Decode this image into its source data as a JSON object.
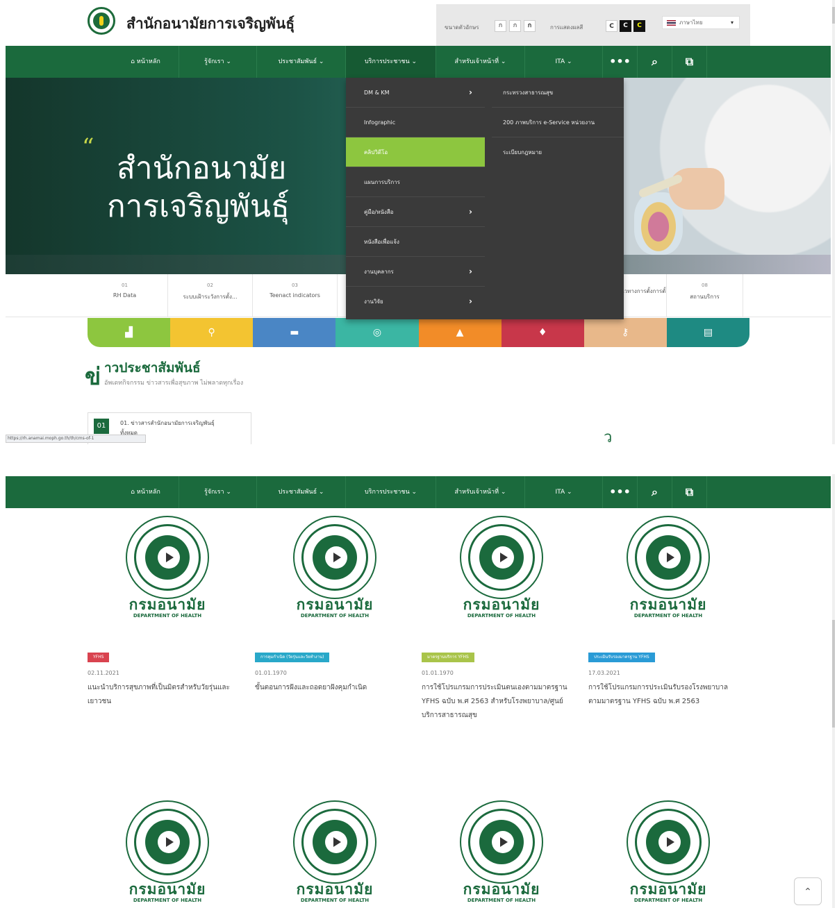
{
  "header": {
    "site_title": "สำนักอนามัยการเจริญพันธุ์",
    "font_size_label": "ขนาดตัวอักษร",
    "font_sizes": [
      "ก",
      "ก",
      "ก"
    ],
    "contrast_label": "การแสดงผลสี",
    "contrast_opts": [
      "C",
      "C",
      "C"
    ],
    "language": "ภาษาไทย"
  },
  "nav": {
    "home": "หน้าหลัก",
    "about": "รู้จักเรา",
    "pr": "ประชาสัมพันธ์",
    "services": "บริการประชาชน",
    "staff": "สำหรับเจ้าหน้าที่",
    "ita": "ITA"
  },
  "hero": {
    "line1": "สำนักอนามัย",
    "line2": "การเจริญพันธุ์"
  },
  "dropdown": {
    "col1": [
      {
        "label": "DM & KM",
        "arrow": true
      },
      {
        "label": "Infographic",
        "arrow": false
      },
      {
        "label": "คลิปวิดีโอ",
        "arrow": false
      },
      {
        "label": "แผนการบริการ",
        "arrow": false
      },
      {
        "label": "คู่มือ/หนังสือ",
        "arrow": true
      },
      {
        "label": "หนังสือเพื่อแจ้ง",
        "arrow": false
      },
      {
        "label": "งานบุคลากร",
        "arrow": true
      },
      {
        "label": "งานวิจัย",
        "arrow": true
      }
    ],
    "col2": [
      "กระทรวงสาธารณสุข",
      "200 ภาพบริการ e-Service หน่วยงาน",
      "ระเบียบกฎหมาย"
    ]
  },
  "subtabs": [
    {
      "num": "01",
      "label": "RH Data"
    },
    {
      "num": "02",
      "label": "ระบบเฝ้าระวังการตั้ง..."
    },
    {
      "num": "03",
      "label": "Teenact indicators"
    },
    {
      "num": "",
      "label": ""
    },
    {
      "num": "",
      "label": ""
    },
    {
      "num": "",
      "label": ""
    },
    {
      "num": "",
      "label": ""
    },
    {
      "num": "",
      "label": "แนวทางการตั้งการตั้งน"
    },
    {
      "num": "08",
      "label": "สถานบริการ"
    }
  ],
  "news": {
    "title_big": "ข่",
    "title": "าวประชาสัมพันธ์",
    "subtitle": "อัพเดทกิจกรรม ข่าวสารเพื่อสุขภาพ ไม่พลาดทุกเรื่อง",
    "card_icon": "01",
    "card_text": "01. ข่าวสารสำนักอนามัยการเจริญพันธุ์",
    "card_text2": "ทั้งหมด"
  },
  "status_url": "https://rh.anamai.moph.go.th/th/cms-of-1",
  "partial_char": "ว",
  "tile_colors": [
    "#8dc63f",
    "#f3c431",
    "#4a86c5",
    "#3bb6a3",
    "#f28c28",
    "#c8374a",
    "#e8b88a",
    "#1e8a82"
  ],
  "emblem": {
    "th": "กรมอนามัย",
    "en": "DEPARTMENT OF HEALTH"
  },
  "videos": [
    {
      "badge": "YFHS",
      "badge_color": "#d9434f",
      "date": "02.11.2021",
      "title": "แนะนำบริการสุขภาพที่เป็นมิตรสำหรับวัยรุ่นและเยาวชน"
    },
    {
      "badge": "การคุมกำเนิด (วัยรุ่นและวัยทำงาน)",
      "badge_color": "#29a8c9",
      "date": "01.01.1970",
      "title": "ขั้นตอนการฝังและถอดยาฝังคุมกำเนิด"
    },
    {
      "badge": "มาตรฐานบริการ YFHS",
      "badge_color": "#a9c44a",
      "date": "01.01.1970",
      "title": "การใช้โปรแกรมการประเมินตนเองตามมาตรฐาน YFHS ฉบับ พ.ศ 2563 สำหรับโรงพยาบาล/ศูนย์บริการสาธารณสุข"
    },
    {
      "badge": "ประเมินรับรองมาตรฐาน YFHS",
      "badge_color": "#2a9bd6",
      "date": "17.03.2021",
      "title": "การใช้โปรแกรมการประเมินรับรองโรงพยาบาลตามมาตรฐาน YFHS ฉบับ พ.ศ 2563"
    }
  ],
  "back_to_top": "⌃"
}
